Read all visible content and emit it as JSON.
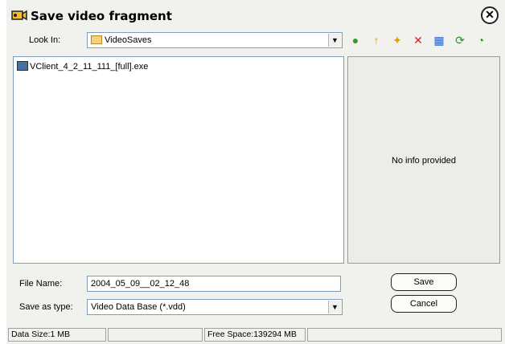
{
  "title": "Save video fragment",
  "close_glyph": "✕",
  "look_in": {
    "label": "Look In:",
    "value": "VideoSaves"
  },
  "toolbar": [
    {
      "name": "back-icon",
      "glyph": "●",
      "color": "#2f9e2f"
    },
    {
      "name": "up-folder-icon",
      "glyph": "↑",
      "color": "#d9a400"
    },
    {
      "name": "new-folder-icon",
      "glyph": "✦",
      "color": "#d9a400"
    },
    {
      "name": "delete-icon",
      "glyph": "✕",
      "color": "#e02020"
    },
    {
      "name": "view-menu-icon",
      "glyph": "▦",
      "color": "#2b62c0"
    },
    {
      "name": "refresh-icon",
      "glyph": "⟳",
      "color": "#2f8f2f"
    },
    {
      "name": "history-icon",
      "glyph": "◔",
      "color": "#2f8f2f"
    }
  ],
  "files": [
    {
      "name": "VClient_4_2_11_111_[full].exe",
      "icon": "exe-icon"
    }
  ],
  "info_panel": {
    "message": "No info provided"
  },
  "file_name": {
    "label": "File Name:",
    "value": "2004_05_09__02_12_48"
  },
  "save_as_type": {
    "label": "Save as type:",
    "value": "Video Data Base (*.vdd)"
  },
  "buttons": {
    "save": "Save",
    "cancel": "Cancel"
  },
  "status": {
    "data_size": "Data Size:1 MB",
    "free_space": "Free Space:139294 MB"
  }
}
